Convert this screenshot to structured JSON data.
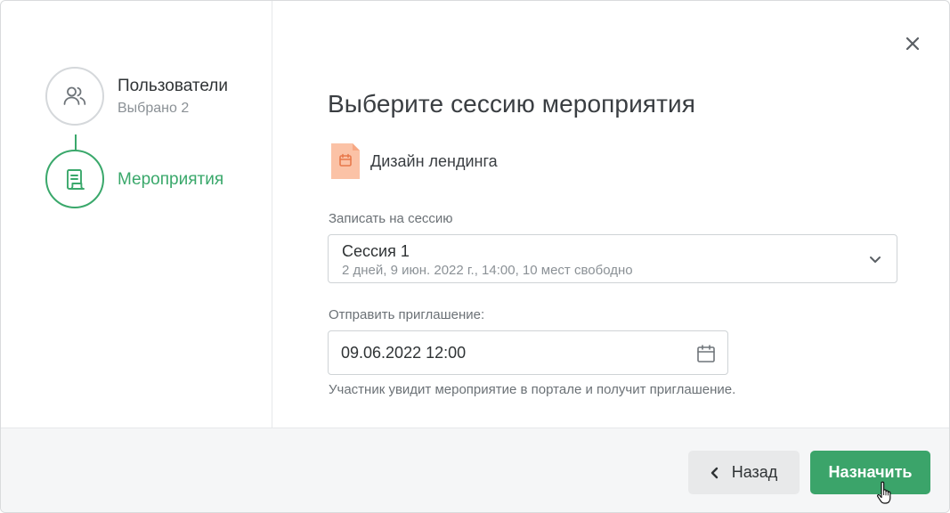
{
  "steps": [
    {
      "title": "Пользователи",
      "subtitle": "Выбрано 2",
      "icon": "users-icon",
      "state": "completed"
    },
    {
      "title": "Мероприятия",
      "icon": "document-icon",
      "state": "active"
    }
  ],
  "header": {
    "title": "Выберите сессию мероприятия"
  },
  "event": {
    "name": "Дизайн лендинга",
    "icon": "calendar-file-icon"
  },
  "session_field": {
    "label": "Записать на сессию",
    "selected_name": "Сессия 1",
    "selected_details": "2 дней, 9 июн. 2022 г., 14:00, 10 мест свободно"
  },
  "invite_field": {
    "label": "Отправить приглашение:",
    "value": "09.06.2022 12:00",
    "hint": "Участник увидит мероприятие в портале и получит приглашение."
  },
  "footer": {
    "back_label": "Назад",
    "assign_label": "Назначить"
  },
  "colors": {
    "accent": "#3ba46a",
    "event_icon": "#fbc2a6",
    "muted": "#8b9196"
  }
}
